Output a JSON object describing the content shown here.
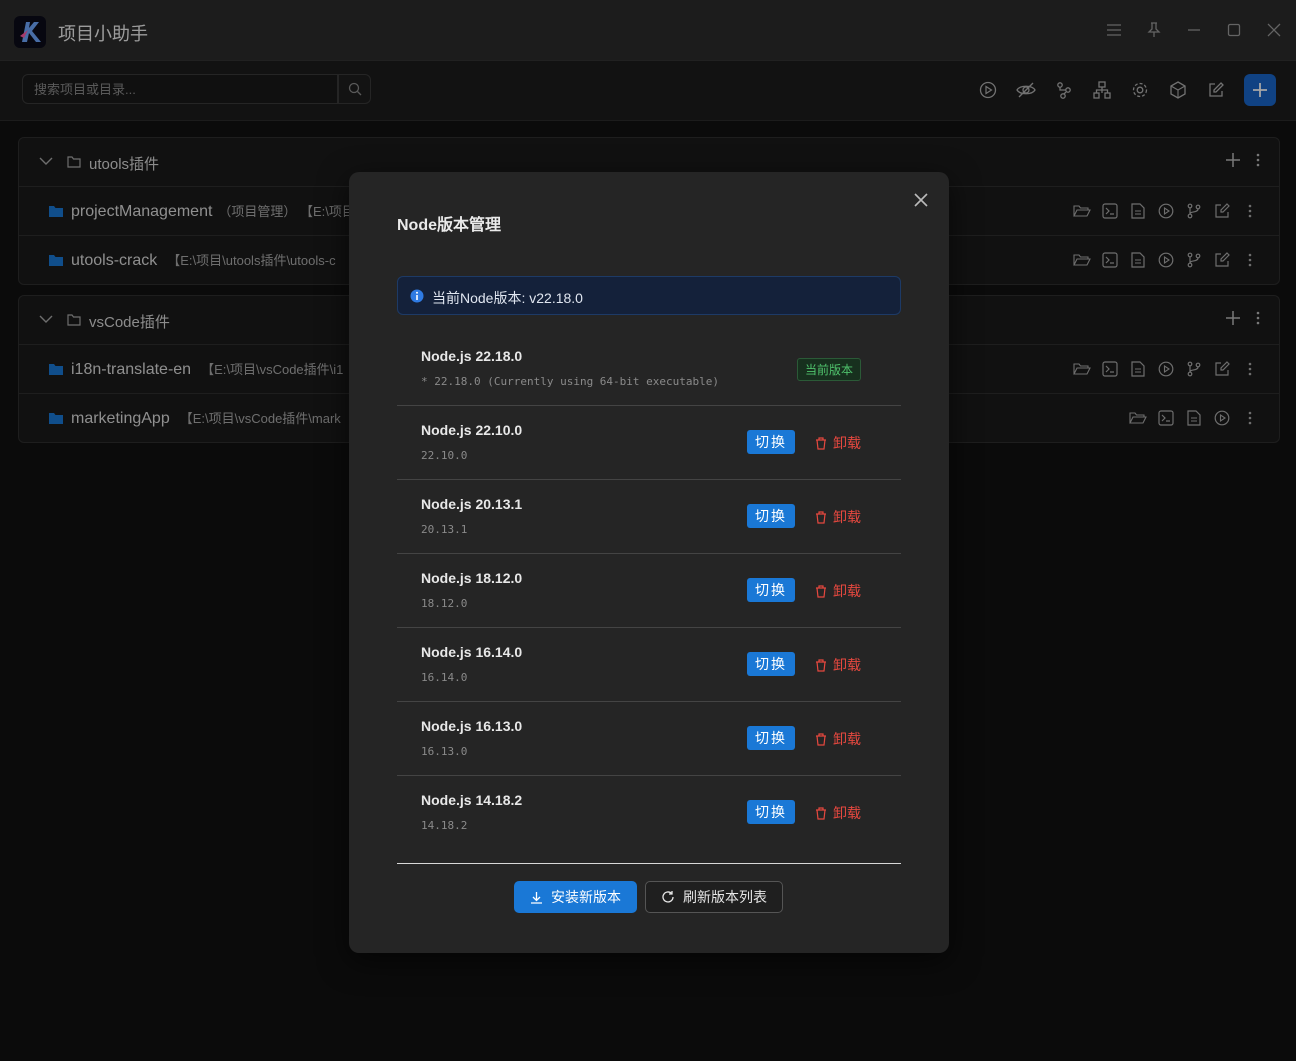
{
  "app": {
    "title": "项目小助手"
  },
  "search": {
    "placeholder": "搜索项目或目录..."
  },
  "groups": [
    {
      "name": "utools插件",
      "projects": [
        {
          "name": "projectManagement",
          "alias": "（项目管理）",
          "path": "【E:\\项目"
        },
        {
          "name": "utools-crack",
          "alias": "",
          "path": "【E:\\项目\\utools插件\\utools-c"
        }
      ]
    },
    {
      "name": "vsCode插件",
      "projects": [
        {
          "name": "i18n-translate-en",
          "alias": "",
          "path": "【E:\\项目\\vsCode插件\\i1"
        },
        {
          "name": "marketingApp",
          "alias": "",
          "path": "【E:\\项目\\vsCode插件\\mark"
        }
      ]
    }
  ],
  "modal": {
    "title": "Node版本管理",
    "current_info": "当前Node版本: v22.18.0",
    "versions": [
      {
        "name": "Node.js 22.18.0",
        "detail": "* 22.18.0 (Currently using 64-bit executable)",
        "current_tag": "当前版本"
      },
      {
        "name": "Node.js 22.10.0",
        "detail": "22.10.0"
      },
      {
        "name": "Node.js 20.13.1",
        "detail": "20.13.1"
      },
      {
        "name": "Node.js 18.12.0",
        "detail": "18.12.0"
      },
      {
        "name": "Node.js 16.14.0",
        "detail": "16.14.0"
      },
      {
        "name": "Node.js 16.13.0",
        "detail": "16.13.0"
      },
      {
        "name": "Node.js 14.18.2",
        "detail": "14.18.2"
      }
    ],
    "switch_label": "切换",
    "uninstall_label": "卸载",
    "install_label": "安装新版本",
    "refresh_label": "刷新版本列表"
  },
  "colors": {
    "accent": "#1a78d6",
    "danger": "#e5483f",
    "success": "#4fc26c",
    "info_bg": "#14213a"
  }
}
